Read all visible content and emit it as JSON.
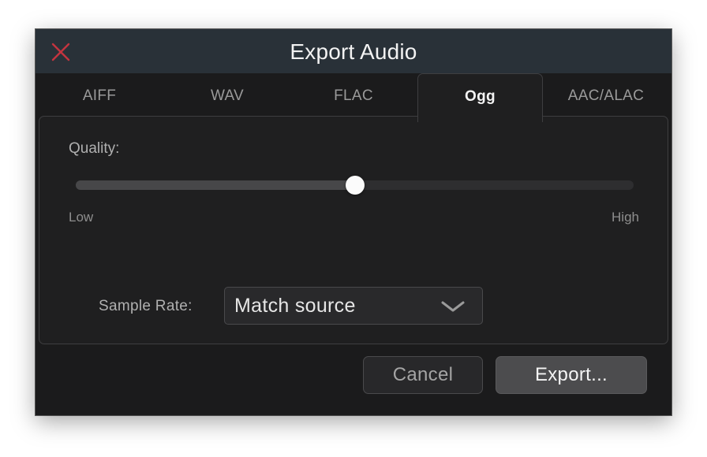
{
  "window": {
    "title": "Export Audio",
    "close_icon": "close-x-icon",
    "close_color": "#c4343f"
  },
  "tabs": [
    {
      "label": "AIFF",
      "active": false
    },
    {
      "label": "WAV",
      "active": false
    },
    {
      "label": "FLAC",
      "active": false
    },
    {
      "label": "Ogg",
      "active": true
    },
    {
      "label": "AAC/ALAC",
      "active": false
    }
  ],
  "quality": {
    "label": "Quality:",
    "value_fraction": 0.5,
    "min_label": "Low",
    "max_label": "High"
  },
  "sample_rate": {
    "label": "Sample Rate:",
    "selected": "Match source",
    "chevron_icon": "chevron-down-icon"
  },
  "buttons": {
    "cancel_label": "Cancel",
    "export_label": "Export..."
  },
  "colors": {
    "titlebar": "#293138",
    "dialog_background": "#1b1b1c",
    "panel_background": "#1f1f20",
    "slider_thumb": "#fbfbfb"
  }
}
